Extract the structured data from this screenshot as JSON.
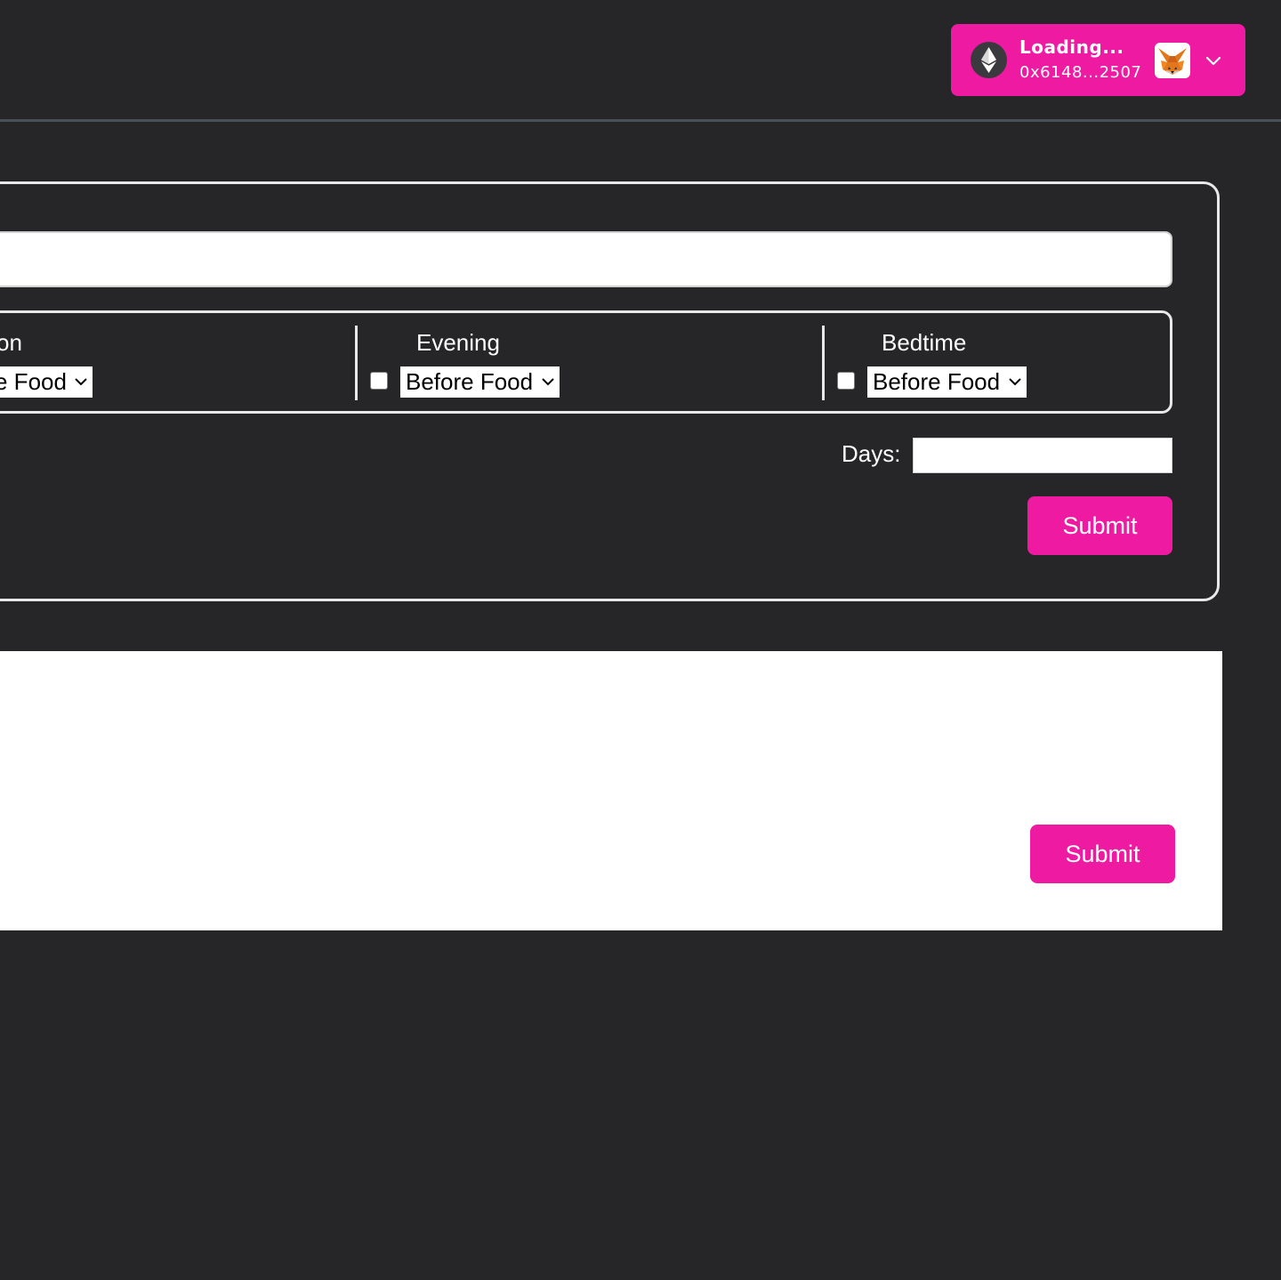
{
  "header": {
    "wallet": {
      "status": "Loading...",
      "address": "0x6148...2507",
      "network_icon": "ethereum-icon",
      "avatar_icon": "metamask-fox-icon",
      "menu_icon": "chevron-down-icon"
    }
  },
  "form": {
    "name_input": {
      "value": "",
      "placeholder": ""
    },
    "schedule": [
      {
        "label": "on",
        "checked": false,
        "select_value": "e Food"
      },
      {
        "label": "Evening",
        "checked": false,
        "select_value": "Before Food"
      },
      {
        "label": "Bedtime",
        "checked": false,
        "select_value": "Before Food"
      }
    ],
    "days": {
      "label": "Days:",
      "value": ""
    },
    "submit_label": "Submit"
  },
  "panel": {
    "submit_label": "Submit"
  },
  "colors": {
    "background": "#262628",
    "accent": "#ef1aa2",
    "border": "#e8e8e8",
    "divider": "#4a5058"
  }
}
